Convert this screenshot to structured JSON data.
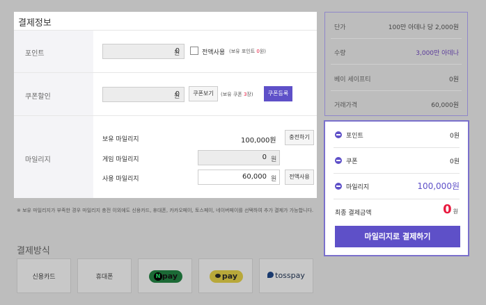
{
  "payment_info": {
    "title": "결제정보",
    "point": {
      "label": "포인트",
      "value": "0",
      "unit": "원",
      "use_all_label": "전액사용",
      "held_prefix": "(보유 포인트 ",
      "held_value": "0",
      "held_suffix": "원)"
    },
    "coupon": {
      "label": "쿠폰할인",
      "value": "0",
      "unit": "원",
      "view_button": "쿠폰보기",
      "held_prefix": "(보유 쿠폰 ",
      "held_value": "3",
      "held_suffix": "장)",
      "register_button": "쿠폰등록"
    },
    "mileage": {
      "label": "마일리지",
      "held_label": "보유 마일리지",
      "held_value": "100,000원",
      "charge_button": "충전하기",
      "game_label": "게임 마일리지",
      "game_value": "0",
      "game_unit": "원",
      "use_label": "사용 마일리지",
      "use_value": "60,000",
      "use_unit": "원",
      "use_all_button": "전액사용"
    }
  },
  "notice": "※ 보유 마일리지가 부족한 경우 마일리지 충전 이외에도 신용카드, 휴대폰, 카카오페이, 토스페이, 네이버페이를 선택하여 추가 결제가 가능합니다.",
  "methods": {
    "title": "결제방식",
    "items": [
      {
        "label": "신용카드"
      },
      {
        "label": "휴대폰"
      },
      {
        "label": "pay",
        "prefix": "N"
      },
      {
        "label": "pay"
      },
      {
        "label": "tosspay"
      }
    ]
  },
  "summary": {
    "rows": [
      {
        "label": "단가",
        "value": "100만 아데나 당 2,000원"
      },
      {
        "label": "수량",
        "value": "3,000만 아데나"
      },
      {
        "label": "베이 세이프티",
        "value": "0원"
      },
      {
        "label": "거래가격",
        "value": "60,000원"
      }
    ],
    "deductions": [
      {
        "label": "포인트",
        "value": "0원"
      },
      {
        "label": "쿠폰",
        "value": "0원"
      },
      {
        "label": "마일리지",
        "value": "100,000원"
      }
    ],
    "final_label": "최종 결제금액",
    "final_value": "0",
    "final_unit": "원",
    "pay_button": "마일리지로 결제하기"
  },
  "colors": {
    "accent": "#5e50c8",
    "highlight_red": "#e8193e",
    "overlay": "#bdbdbd",
    "naver": "#03c75a",
    "kakao": "#fee500",
    "toss": "#0064ff"
  }
}
